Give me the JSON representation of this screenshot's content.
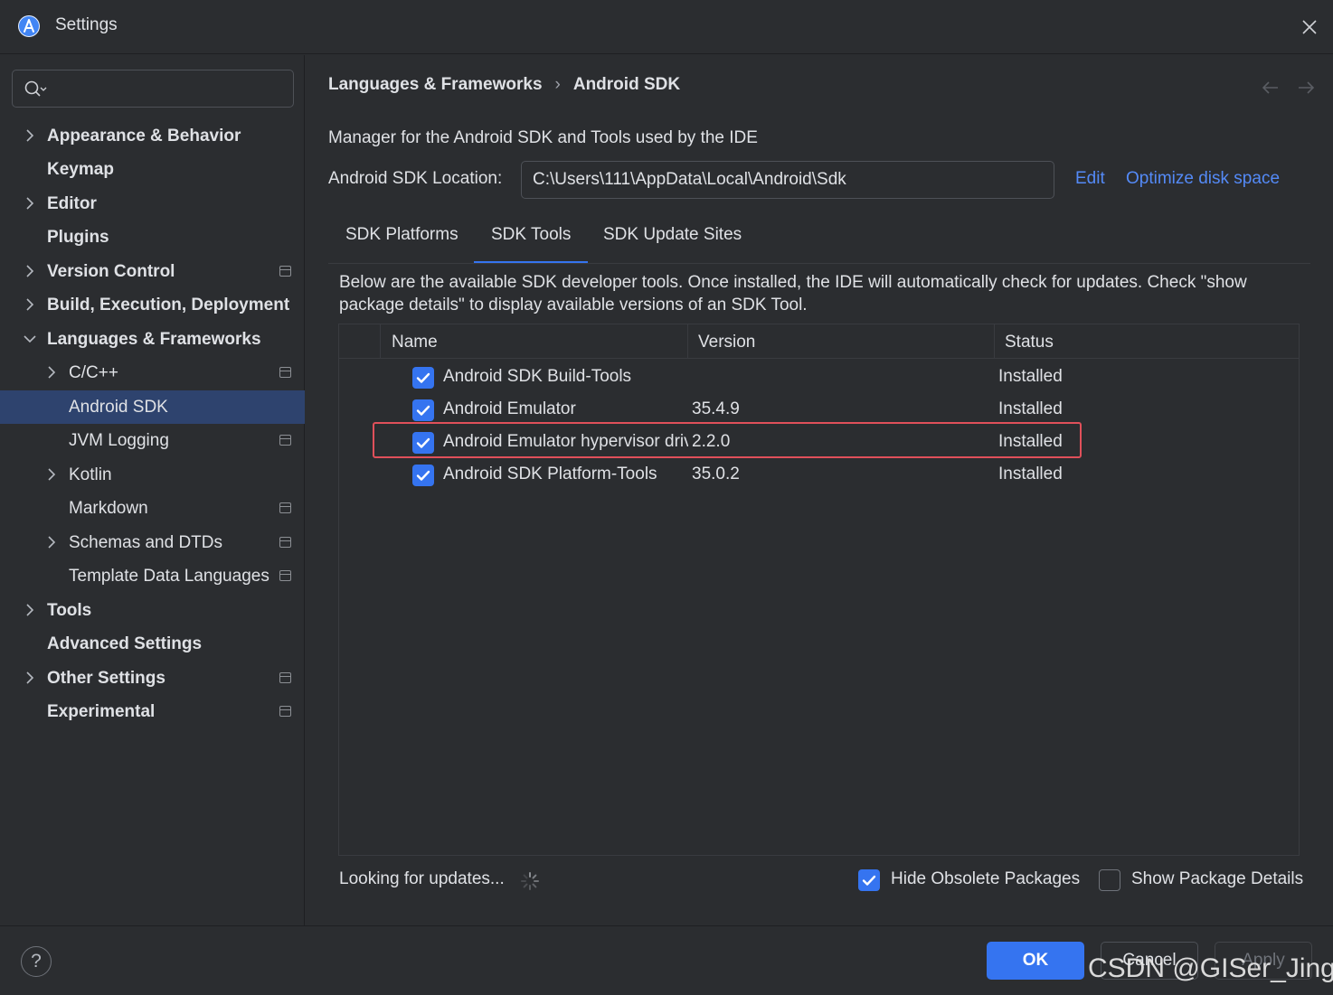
{
  "window": {
    "title": "Settings",
    "logo_icon": "android-studio-icon",
    "close_icon": "close-icon"
  },
  "sidebar": {
    "search": {
      "value": "",
      "placeholder": ""
    },
    "items": [
      {
        "label": "Appearance & Behavior",
        "level": 0,
        "expandable": true,
        "expanded": false,
        "bold": true,
        "project_icon": false
      },
      {
        "label": "Keymap",
        "level": 0,
        "expandable": false,
        "bold": true,
        "project_icon": false
      },
      {
        "label": "Editor",
        "level": 0,
        "expandable": true,
        "expanded": false,
        "bold": true,
        "project_icon": false
      },
      {
        "label": "Plugins",
        "level": 0,
        "expandable": false,
        "bold": true,
        "project_icon": false
      },
      {
        "label": "Version Control",
        "level": 0,
        "expandable": true,
        "expanded": false,
        "bold": true,
        "project_icon": true
      },
      {
        "label": "Build, Execution, Deployment",
        "level": 0,
        "expandable": true,
        "expanded": false,
        "bold": true,
        "project_icon": false
      },
      {
        "label": "Languages & Frameworks",
        "level": 0,
        "expandable": true,
        "expanded": true,
        "bold": true,
        "project_icon": false
      },
      {
        "label": "C/C++",
        "level": 1,
        "expandable": true,
        "expanded": false,
        "bold": false,
        "project_icon": true
      },
      {
        "label": "Android SDK",
        "level": 1,
        "expandable": false,
        "bold": false,
        "selected": true,
        "project_icon": false
      },
      {
        "label": "JVM Logging",
        "level": 1,
        "expandable": false,
        "bold": false,
        "project_icon": true
      },
      {
        "label": "Kotlin",
        "level": 1,
        "expandable": true,
        "expanded": false,
        "bold": false,
        "project_icon": false
      },
      {
        "label": "Markdown",
        "level": 1,
        "expandable": false,
        "bold": false,
        "project_icon": true
      },
      {
        "label": "Schemas and DTDs",
        "level": 1,
        "expandable": true,
        "expanded": false,
        "bold": false,
        "project_icon": true
      },
      {
        "label": "Template Data Languages",
        "level": 1,
        "expandable": false,
        "bold": false,
        "project_icon": true
      },
      {
        "label": "Tools",
        "level": 0,
        "expandable": true,
        "expanded": false,
        "bold": true,
        "project_icon": false
      },
      {
        "label": "Advanced Settings",
        "level": 0,
        "expandable": false,
        "bold": true,
        "project_icon": false
      },
      {
        "label": "Other Settings",
        "level": 0,
        "expandable": true,
        "expanded": false,
        "bold": true,
        "project_icon": true
      },
      {
        "label": "Experimental",
        "level": 0,
        "expandable": false,
        "bold": true,
        "project_icon": true
      }
    ]
  },
  "main": {
    "breadcrumb": [
      "Languages & Frameworks",
      "Android SDK"
    ],
    "breadcrumb_separator": "›",
    "description": "Manager for the Android SDK and Tools used by the IDE",
    "sdk_location": {
      "label": "Android SDK Location:",
      "value": "C:\\Users\\111\\AppData\\Local\\Android\\Sdk"
    },
    "edit_link": "Edit",
    "optimize_link": "Optimize disk space",
    "tabs": [
      {
        "label": "SDK Platforms",
        "active": false
      },
      {
        "label": "SDK Tools",
        "active": true
      },
      {
        "label": "SDK Update Sites",
        "active": false
      }
    ],
    "info_text": "Below are the available SDK developer tools. Once installed, the IDE will automatically check for updates. Check \"show package details\" to display available versions of an SDK Tool.",
    "table": {
      "columns": [
        "Name",
        "Version",
        "Status"
      ],
      "rows": [
        {
          "checked": true,
          "name": "Android SDK Build-Tools",
          "version": "",
          "status": "Installed"
        },
        {
          "checked": true,
          "name": "Android Emulator",
          "version": "35.4.9",
          "status": "Installed"
        },
        {
          "checked": true,
          "name": "Android Emulator hypervisor driver",
          "version": "2.2.0",
          "status": "Installed",
          "highlighted": true
        },
        {
          "checked": true,
          "name": "Android SDK Platform-Tools",
          "version": "35.0.2",
          "status": "Installed"
        }
      ]
    },
    "status_text": "Looking for updates...",
    "hide_obsolete": {
      "label": "Hide Obsolete Packages",
      "checked": true
    },
    "show_details": {
      "label": "Show Package Details",
      "checked": false
    }
  },
  "footer": {
    "help_label": "?",
    "ok_label": "OK",
    "cancel_label": "Cancel",
    "apply_label": "Apply"
  },
  "watermark": "CSDN @GISer_Jinger",
  "colors": {
    "accent": "#3574f0",
    "link": "#548af7",
    "highlight_box": "#e0505a",
    "selection": "#2e436e",
    "background": "#2b2d30"
  }
}
